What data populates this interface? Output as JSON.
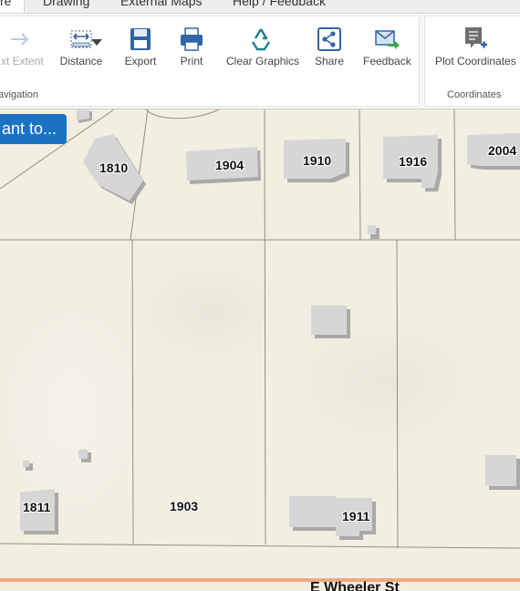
{
  "tabs": [
    {
      "label": "re",
      "active": true
    },
    {
      "label": "Drawing",
      "active": false
    },
    {
      "label": "External Maps",
      "active": false
    },
    {
      "label": "Help / Feedback",
      "active": false
    }
  ],
  "ribbon": {
    "navigation": {
      "group_label": "avigation",
      "tools": [
        {
          "label": "xt Extent",
          "icon": "arrow-right-icon",
          "enabled": false
        },
        {
          "label": "Distance",
          "icon": "measure-distance-icon",
          "enabled": true
        }
      ]
    },
    "export_label": "Export",
    "print_label": "Print",
    "clear_graphics_label": "Clear Graphics",
    "share_label": "Share",
    "feedback_label": "Feedback",
    "coordinates": {
      "group_label": "Coordinates",
      "plot_label": "Plot Coordinates"
    }
  },
  "map": {
    "place_button_label": "ant to...",
    "addresses": [
      "1810",
      "1904",
      "1910",
      "1916",
      "2004",
      "1811",
      "1903",
      "1911"
    ],
    "street_label": "E Wheeler St",
    "colors": {
      "street": "#f1a882",
      "parcel_line": "#9a8c78",
      "building": "#d4d4d4"
    }
  }
}
